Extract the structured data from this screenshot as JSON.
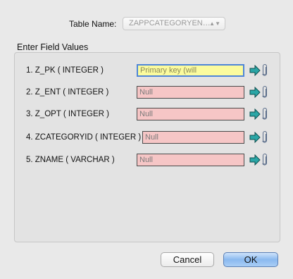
{
  "table_name": {
    "label": "Table Name:",
    "selected": "ZAPPCATEGORYEN…"
  },
  "section_title": "Enter Field Values",
  "fields": [
    {
      "label": "1. Z_PK ( INTEGER )",
      "value": "Primary key (will",
      "state": "primary-key"
    },
    {
      "label": "2. Z_ENT ( INTEGER )",
      "value": "Null",
      "state": "null"
    },
    {
      "label": "3. Z_OPT ( INTEGER )",
      "value": "Null",
      "state": "null"
    },
    {
      "label": "4. ZCATEGORYID ( INTEGER )",
      "value": "Null",
      "state": "null"
    },
    {
      "label": "5. ZNAME ( VARCHAR )",
      "value": "Null",
      "state": "null"
    }
  ],
  "buttons": {
    "cancel": "Cancel",
    "ok": "OK"
  },
  "colors": {
    "null_field": "#f6c6c6",
    "primary_key_field": "#fbfb9e",
    "go_arrow": "#2aa6a6",
    "ok_button": "#8ab9ef"
  },
  "icons": {
    "go": "go-arrow-icon",
    "attach": "paperclip-icon",
    "select": "updown-chevron-icon"
  }
}
